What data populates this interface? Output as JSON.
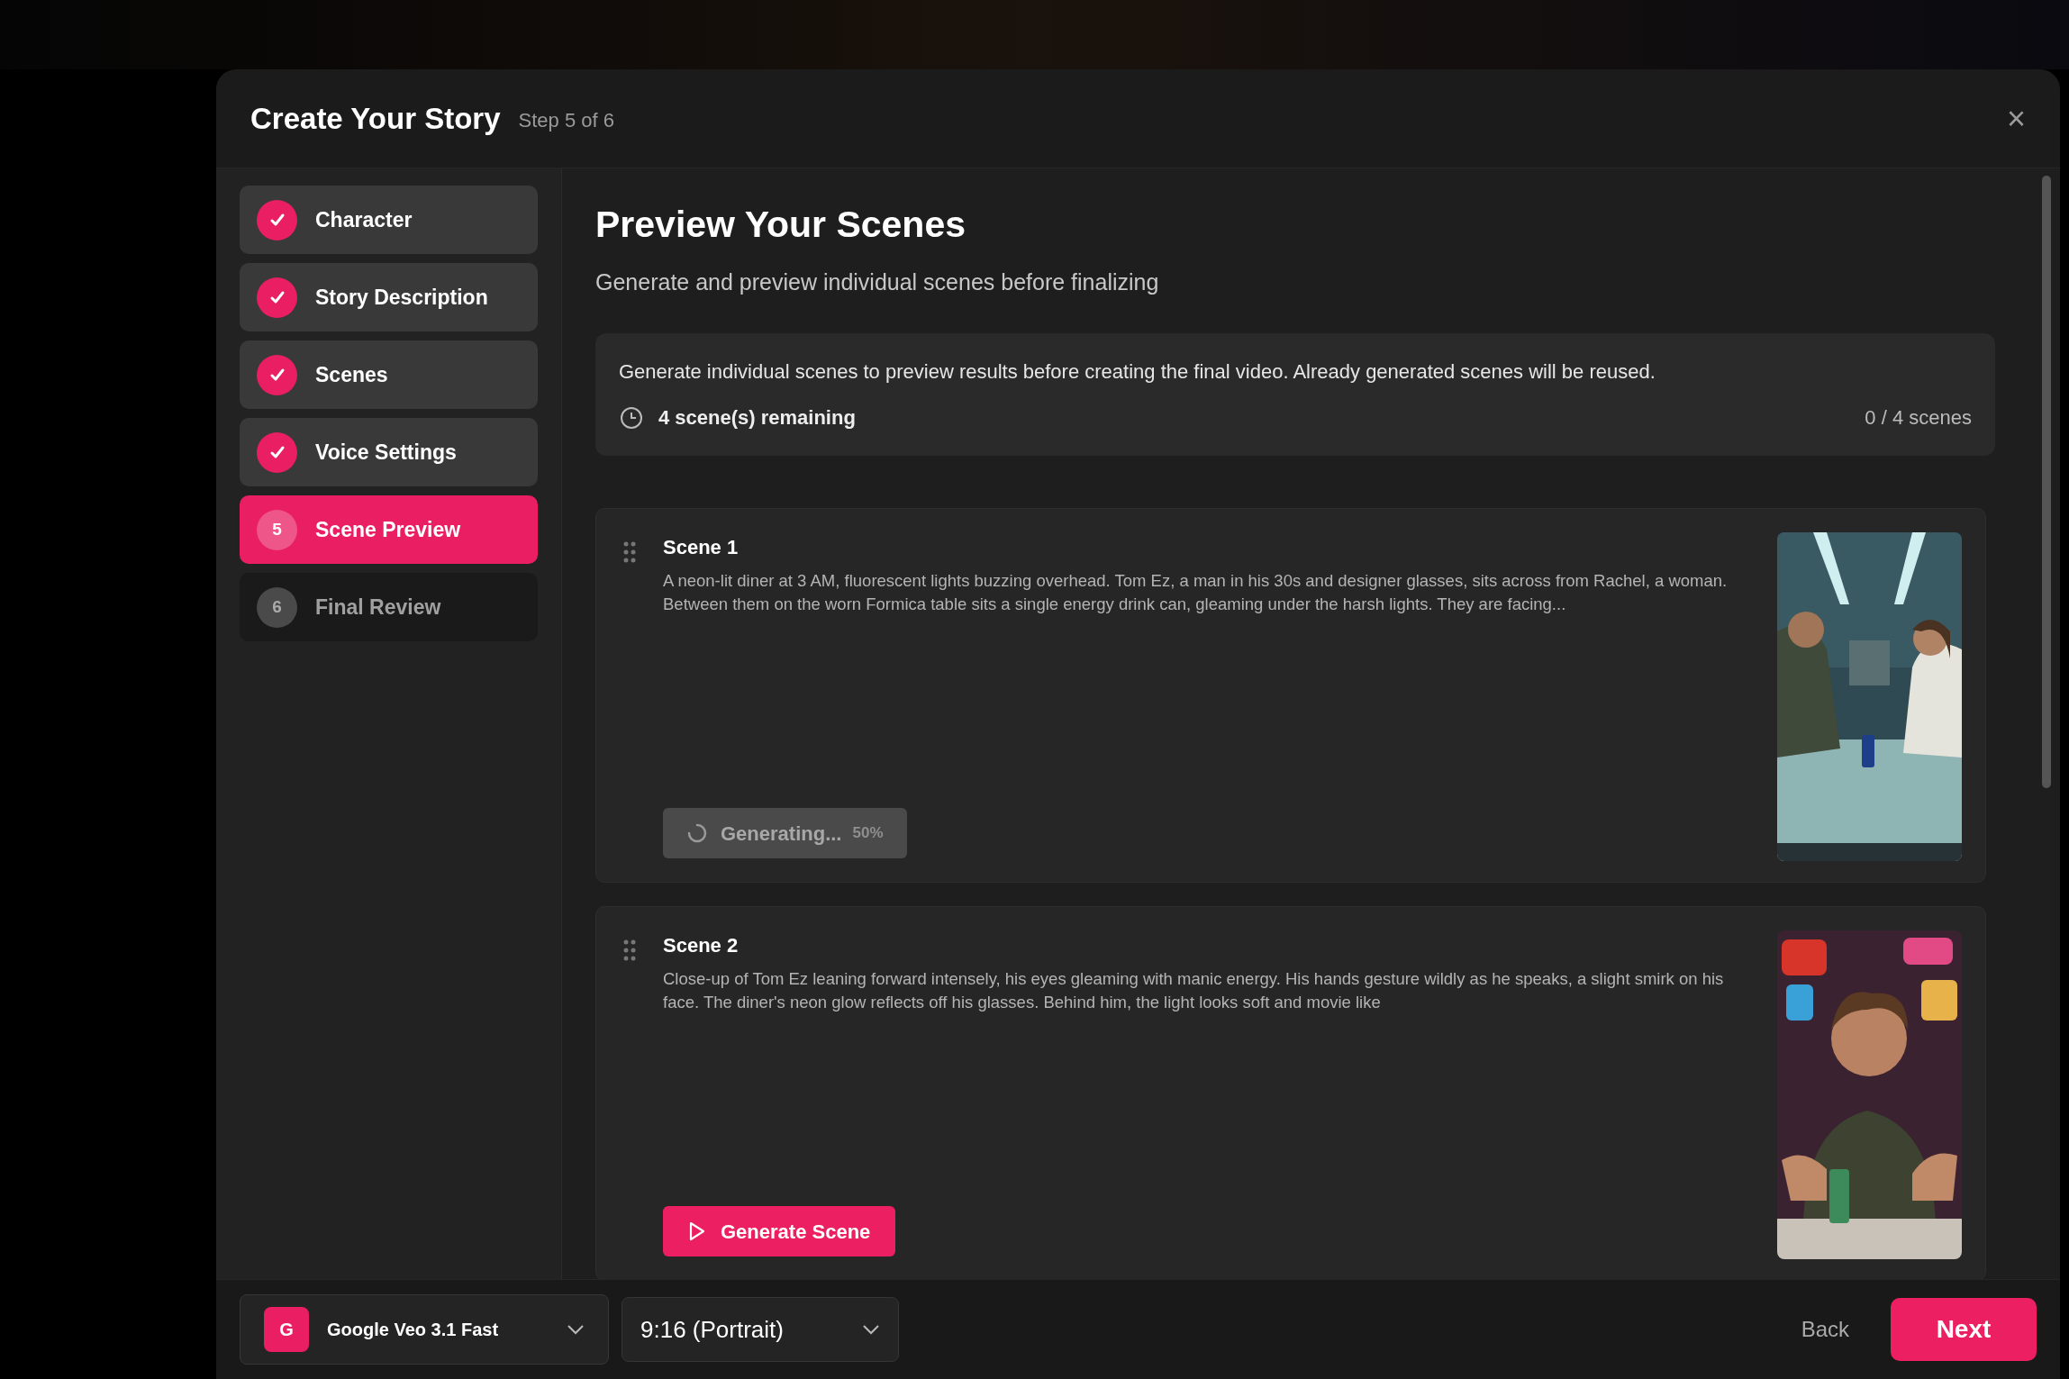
{
  "dialog": {
    "title": "Create Your Story",
    "step": "Step 5 of 6",
    "close": "×"
  },
  "steps": [
    {
      "label": "Character",
      "done": true,
      "selected": false
    },
    {
      "label": "Story Description",
      "done": true,
      "selected": false
    },
    {
      "label": "Scenes",
      "done": true,
      "selected": false
    },
    {
      "label": "Voice Settings",
      "done": true,
      "selected": false
    },
    {
      "number": "5",
      "label": "Scene Preview",
      "done": false,
      "selected": true
    },
    {
      "number": "6",
      "label": "Final Review",
      "done": false,
      "selected": false
    }
  ],
  "heading": "Preview Your Scenes",
  "subheading": "Generate and preview individual scenes before finalizing",
  "info": {
    "text": "Generate individual scenes to preview results before creating the final video. Already generated scenes will be reused.",
    "remaining": "4 scene(s) remaining",
    "count": "0 / 4 scenes"
  },
  "scenes": [
    {
      "title": "Scene 1",
      "description": "A neon-lit diner at 3 AM, fluorescent lights buzzing overhead. Tom Ez, a man in his 30s and designer glasses, sits across from Rachel, a woman. Between them on the worn Formica table sits a single energy drink can, gleaming under the harsh lights. They are facing...",
      "kind": "generating",
      "button": "Generating...",
      "progress": "50%"
    },
    {
      "title": "Scene 2",
      "description": "Close-up of Tom Ez leaning forward intensely, his eyes gleaming with manic energy. His hands gesture wildly as he speaks, a slight smirk on his face. The diner's neon glow reflects off his glasses. Behind him, the light looks soft and movie like",
      "kind": "idle",
      "button": "Generate Scene"
    }
  ],
  "footer": {
    "model": {
      "badge": "G",
      "label": "Google Veo 3.1 Fast"
    },
    "aspect": "9:16 (Portrait)",
    "back": "Back",
    "next": "Next"
  }
}
